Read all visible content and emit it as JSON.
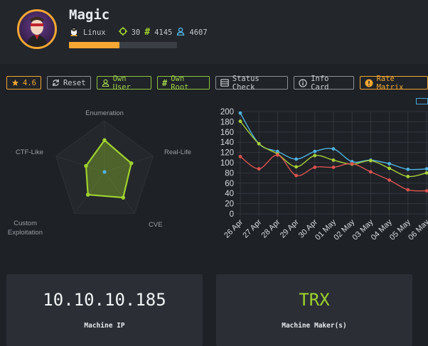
{
  "machine": {
    "name": "Magic",
    "os": "Linux",
    "points": "30",
    "user_owns": "4145",
    "root_owns": "4607",
    "progress": 0.47
  },
  "buttons": {
    "rating": "4.6",
    "reset": "Reset",
    "own_user": "Own User",
    "own_root": "Own Root",
    "status_check": "Status Check",
    "info_card": "Info Card",
    "rate_matrix": "Rate Matrix"
  },
  "radar": {
    "labels": [
      "Enumeration",
      "Real-Life",
      "CVE",
      "Custom Exploitation",
      "CTF-Like"
    ],
    "values": [
      0.62,
      0.55,
      0.62,
      0.55,
      0.38
    ],
    "color": "#9fd22e"
  },
  "chart_data": {
    "type": "line",
    "categories": [
      "26 Apr",
      "27 Apr",
      "28 Apr",
      "29 Apr",
      "30 Apr",
      "01 May",
      "02 May",
      "03 May",
      "04 May",
      "05 May",
      "06 May"
    ],
    "ylim": [
      0,
      200
    ],
    "yticks": [
      0,
      20,
      40,
      60,
      80,
      100,
      120,
      140,
      160,
      180,
      200
    ],
    "series": [
      {
        "color": "#4fb3e0",
        "values": [
          197,
          137,
          122,
          107,
          122,
          127,
          102,
          105,
          98,
          87,
          88
        ]
      },
      {
        "color": "#a9cf38",
        "values": [
          181,
          137,
          117,
          92,
          114,
          105,
          97,
          104,
          89,
          73,
          80
        ]
      },
      {
        "color": "#d9534f",
        "values": [
          112,
          88,
          115,
          75,
          91,
          91,
          98,
          82,
          66,
          47,
          45
        ]
      }
    ]
  },
  "cards": {
    "ip": {
      "value": "10.10.10.185",
      "label": "Machine IP",
      "color": "#f2f4f6"
    },
    "maker": {
      "value": "TRX",
      "label": "Machine Maker(s)",
      "color": "#9fd22e"
    }
  }
}
